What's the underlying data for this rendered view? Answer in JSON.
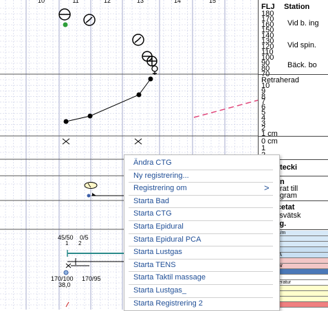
{
  "timeline": {
    "hour_labels": [
      "10",
      "11",
      "12",
      "13",
      "14",
      "15"
    ],
    "dilation_ticks": [
      "1 cm",
      "0 cm"
    ]
  },
  "chart_notes": {
    "vitals_top": "45/50",
    "vitals_top_b": "0/5",
    "small_1": "1",
    "small_2": "2",
    "bp_1": "170/100",
    "bp_2": "170/95",
    "temp": "38,0"
  },
  "panel": {
    "flj_header": "FLJ",
    "station_header": "Station",
    "flj_values": [
      "180",
      "170",
      "160",
      "150",
      "140",
      "130",
      "120",
      "110",
      "100",
      "90",
      "80",
      "70"
    ],
    "station_labels": [
      "Vid b. ing",
      "Vid spin.",
      "Bäck. bo"
    ],
    "retraherad": "Retraherad",
    "dilation_values": [
      "10",
      "9",
      "8",
      "7",
      "6",
      "5",
      "4",
      "3",
      "2",
      "1 cm"
    ],
    "zero_cm": "0 cm",
    "zero_sub": [
      "1",
      "2"
    ],
    "section_1": "rnalantecki",
    "section_2": "tocinon",
    "section_2_sub1": "ncentrat till",
    "section_2_sub2": "mikrogram",
    "section_3": "ger-Acetat",
    "section_3_sub": "usionsvätsk",
    "section_4": "em. reg.",
    "strips": [
      {
        "label": "intervall s/m",
        "color": "#d6e8f7"
      },
      {
        "label": "styrka",
        "color": "#d6e8f7"
      },
      {
        "label": "tvärkar",
        "color": "#d6e8f7"
      },
      {
        "label": "",
        "color": "#c8dff2"
      },
      {
        "label": "dural PCA",
        "color": "#c8dff2"
      },
      {
        "label": "gas",
        "color": "#f3c6c6"
      },
      {
        "label": "ma kuddar",
        "color": "#f3c6c6"
      },
      {
        "label": "iotomi",
        "color": "#4b78b8"
      },
      {
        "label": "dtryck",
        "color": "#ffffff"
      },
      {
        "label": "ppstemperatur",
        "color": "#ffffff"
      },
      {
        "label": "ning",
        "color": "#ffffcc"
      },
      {
        "label": "",
        "color": "#ffffcc"
      },
      {
        "label": "ställning",
        "color": "#ffffcc"
      },
      {
        "label": "dning",
        "color": "#f08080"
      }
    ]
  },
  "context_menu": {
    "items": [
      {
        "label": "Ändra CTG",
        "submenu": false
      },
      {
        "label": "Ny registrering...",
        "submenu": false
      },
      {
        "label": "Registrering om",
        "submenu": true
      },
      {
        "label": "Starta Bad",
        "submenu": false
      },
      {
        "label": "Starta CTG",
        "submenu": false
      },
      {
        "label": "Starta Epidural",
        "submenu": false
      },
      {
        "label": "Starta Epidural PCA",
        "submenu": false
      },
      {
        "label": "Starta Lustgas",
        "submenu": false
      },
      {
        "label": "Starta TENS",
        "submenu": false
      },
      {
        "label": "Starta Taktil massage",
        "submenu": false
      },
      {
        "label": "Starta Lustgas_",
        "submenu": false
      },
      {
        "label": "Starta Registrering 2",
        "submenu": false
      }
    ],
    "submenu_arrow": ">"
  },
  "colors": {
    "menu_text": "#1f4e96",
    "grid": "#c9cde6",
    "grid_major": "#9aa0c8",
    "dashed_curve": "#e0457a",
    "green_dot": "#2e9e3a",
    "blue_dot": "#3c5fa8"
  }
}
